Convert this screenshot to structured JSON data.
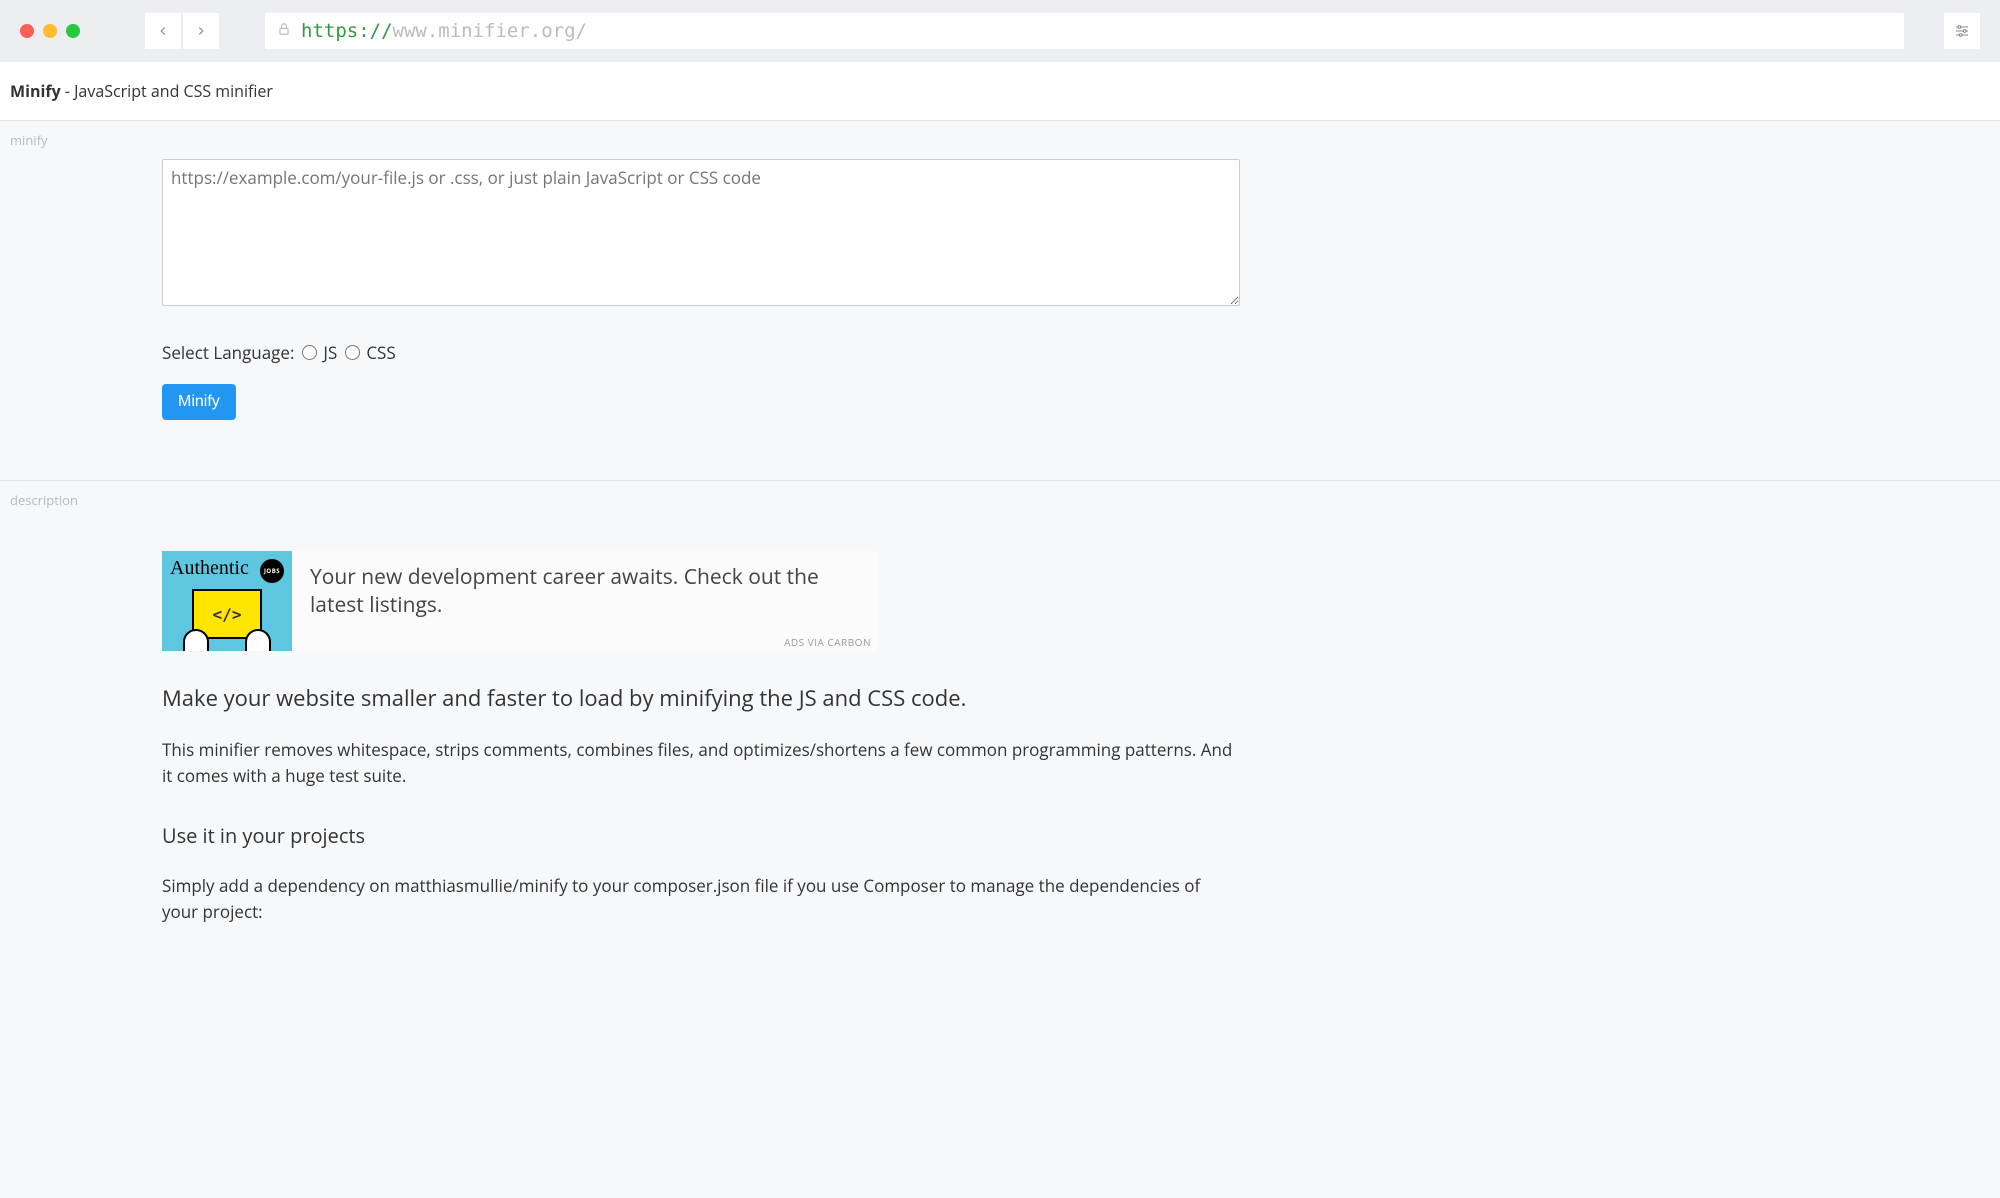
{
  "browser": {
    "url_scheme": "https://",
    "url_rest": "www.minifier.org/"
  },
  "header": {
    "title_strong": "Minify",
    "title_rest": " - JavaScript and CSS minifier"
  },
  "sections": {
    "minify_label": "minify",
    "description_label": "description"
  },
  "form": {
    "textarea_placeholder": "https://example.com/your-file.js or .css, or just plain JavaScript or CSS code",
    "select_language_label": "Select Language:",
    "lang_js_label": "JS",
    "lang_css_label": "CSS",
    "minify_button_label": "Minify"
  },
  "ad": {
    "logo_text": "Authentic",
    "badge_text": "JOBS",
    "screen_text": "</>",
    "copy": "Your new development career awaits. Check out the latest listings.",
    "via": "ADS VIA CARBON"
  },
  "description": {
    "lead": "Make your website smaller and faster to load by minifying the JS and CSS code.",
    "para1": "This minifier removes whitespace, strips comments, combines files, and optimizes/shortens a few common programming patterns. And it comes with a huge test suite.",
    "heading_use": "Use it in your projects",
    "para2": "Simply add a dependency on matthiasmullie/minify to your composer.json file if you use Composer to manage the dependencies of your project:"
  }
}
